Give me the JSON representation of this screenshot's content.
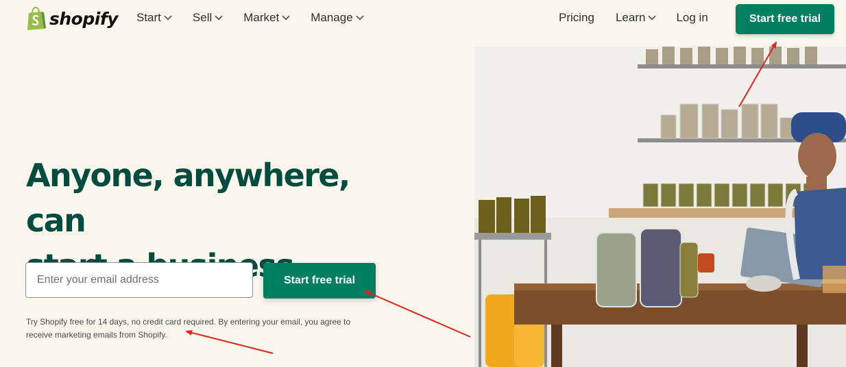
{
  "header": {
    "logo_text": "shopify",
    "nav_left": [
      {
        "label": "Start"
      },
      {
        "label": "Sell"
      },
      {
        "label": "Market"
      },
      {
        "label": "Manage"
      }
    ],
    "nav_right": {
      "pricing": "Pricing",
      "learn": "Learn",
      "login": "Log in"
    },
    "cta_label": "Start free trial"
  },
  "hero": {
    "title_line1": "Anyone, anywhere, can",
    "title_line2": "start a business",
    "email_placeholder": "Enter your email address",
    "cta_label": "Start free trial",
    "disclaimer_line1": "Try Shopify free for 14 days, no credit card required. By entering your email, you agree to",
    "disclaimer_line2": "receive marketing emails from Shopify."
  },
  "colors": {
    "brand_green": "#008060",
    "heading_green": "#004c3f",
    "background": "#fbf7ed",
    "annotation_arrow": "#e8201a"
  },
  "icons": [
    "shopify-bag-icon",
    "chevron-down-icon"
  ]
}
